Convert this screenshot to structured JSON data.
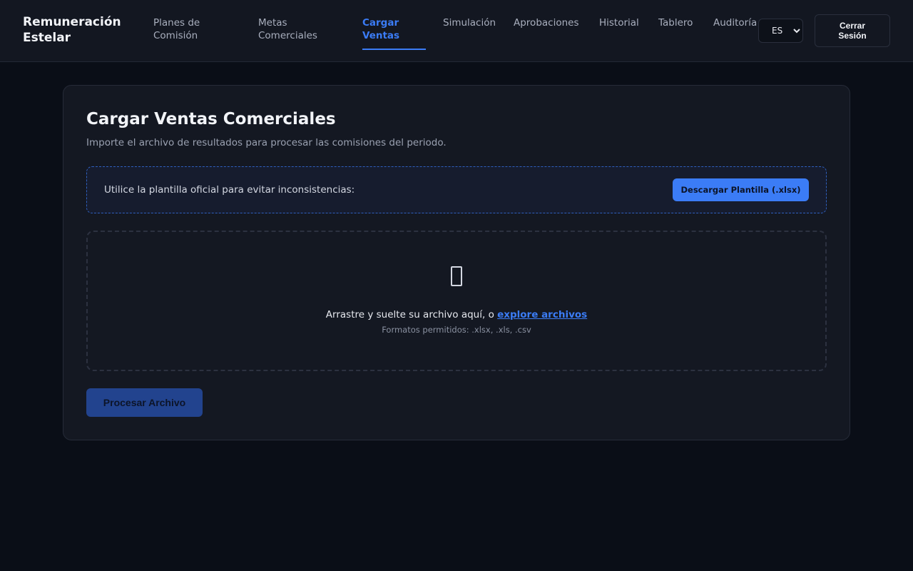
{
  "app": {
    "brand": "Remuneración Estelar"
  },
  "nav": {
    "items": [
      {
        "label": "Planes de Comisión"
      },
      {
        "label": "Metas Comerciales"
      },
      {
        "label": "Cargar Ventas",
        "active": true
      },
      {
        "label": "Simulación"
      },
      {
        "label": "Aprobaciones"
      },
      {
        "label": "Historial"
      },
      {
        "label": "Tablero"
      },
      {
        "label": "Auditoría"
      }
    ]
  },
  "header": {
    "language": "ES",
    "language_options": [
      "ES"
    ],
    "logout_label": "Cerrar Sesión"
  },
  "upload": {
    "title": "Cargar Ventas Comerciales",
    "subtitle": "Importe el archivo de resultados para procesar las comisiones del periodo.",
    "template_text": "Utilice la plantilla oficial para evitar inconsistencias:",
    "template_button": "Descargar Plantilla (.xlsx)",
    "drop_text": "Arrastre y suelte su archivo aquí, o ",
    "drop_link": "explore archivos",
    "formats": "Formatos permitidos: .xlsx, .xls, .csv",
    "upload_icon": "file-upload-icon",
    "process_button": "Procesar Archivo"
  },
  "colors": {
    "accent": "#3b7cf6",
    "background": "#0a0e17",
    "card": "#141822",
    "process_button_disabled": "#22438e"
  }
}
